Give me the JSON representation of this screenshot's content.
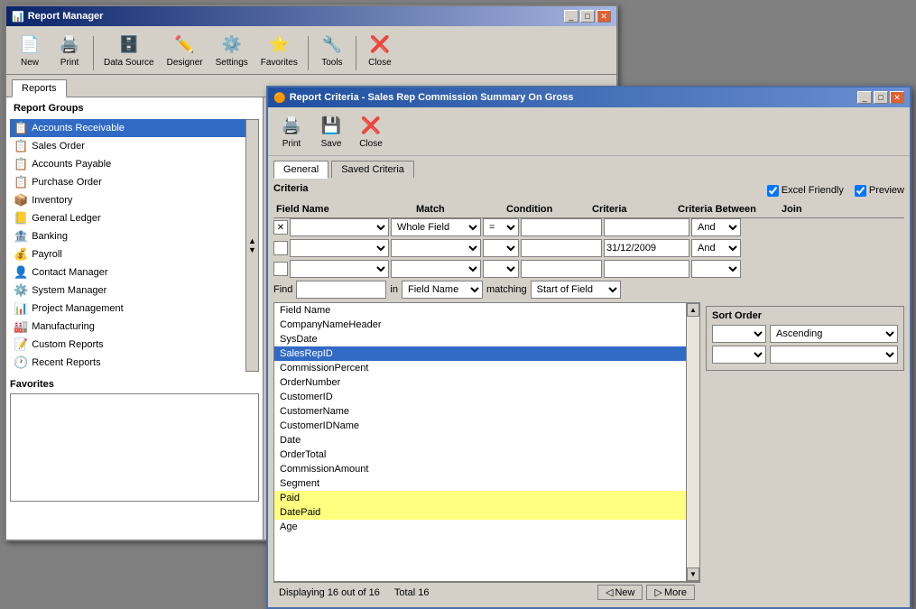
{
  "reportManager": {
    "title": "Report Manager",
    "toolbar": {
      "buttons": [
        {
          "label": "New",
          "icon": "📄",
          "name": "new-button"
        },
        {
          "label": "Print",
          "icon": "🖨️",
          "name": "print-button"
        },
        {
          "label": "Data Source",
          "icon": "🗄️",
          "name": "datasource-button"
        },
        {
          "label": "Designer",
          "icon": "✏️",
          "name": "designer-button"
        },
        {
          "label": "Settings",
          "icon": "⚙️",
          "name": "settings-button"
        },
        {
          "label": "Favorites",
          "icon": "⭐",
          "name": "favorites-button"
        },
        {
          "label": "Tools",
          "icon": "🔧",
          "name": "tools-button"
        },
        {
          "label": "Close",
          "icon": "❌",
          "name": "close-button"
        }
      ]
    },
    "tab": "Reports",
    "sidebarTitle": "Report Groups",
    "sidebarItems": [
      {
        "label": "Accounts Receivable",
        "icon": "📋",
        "selected": true
      },
      {
        "label": "Sales Order",
        "icon": "📋"
      },
      {
        "label": "Accounts Payable",
        "icon": "📋"
      },
      {
        "label": "Purchase Order",
        "icon": "📋"
      },
      {
        "label": "Inventory",
        "icon": "📦"
      },
      {
        "label": "General Ledger",
        "icon": "📒"
      },
      {
        "label": "Banking",
        "icon": "🏦"
      },
      {
        "label": "Payroll",
        "icon": "💰"
      },
      {
        "label": "Contact Manager",
        "icon": "👤"
      },
      {
        "label": "System Manager",
        "icon": "⚙️"
      },
      {
        "label": "Project Management",
        "icon": "📊"
      },
      {
        "label": "Manufacturing",
        "icon": "🏭"
      },
      {
        "label": "Custom Reports",
        "icon": "📝"
      },
      {
        "label": "Recent Reports",
        "icon": "🕐"
      }
    ],
    "favoritesTitle": "Favorites"
  },
  "criteriaWindow": {
    "title": "Report Criteria - Sales Rep Commission Summary On Gross",
    "toolbar": {
      "buttons": [
        {
          "label": "Print",
          "icon": "🖨️",
          "name": "criteria-print-button"
        },
        {
          "label": "Save",
          "icon": "💾",
          "name": "criteria-save-button"
        },
        {
          "label": "Close",
          "icon": "❌",
          "name": "criteria-close-button"
        }
      ]
    },
    "tabs": [
      {
        "label": "General",
        "active": true
      },
      {
        "label": "Saved Criteria",
        "active": false
      }
    ],
    "criteriaLabel": "Criteria",
    "excelFriendly": "Excel Friendly",
    "preview": "Preview",
    "tableHeaders": {
      "fieldName": "Field Name",
      "match": "Match",
      "condition": "Condition",
      "criteria": "Criteria",
      "criteriaBetween": "Criteria Between",
      "join": "Join"
    },
    "rows": [
      {
        "checkbox": "✕",
        "match": "Whole Field",
        "condition": "=",
        "criteria": "",
        "criteriaBetween": "",
        "join": "And"
      },
      {
        "checkbox": "",
        "match": "",
        "condition": "",
        "criteria": "",
        "criteriaBetween": "31/12/2009",
        "join": "And"
      },
      {
        "checkbox": "",
        "match": "",
        "condition": "",
        "criteria": "",
        "criteriaBetween": "",
        "join": ""
      }
    ],
    "findLabel": "Find",
    "inLabel": "in",
    "matchingLabel": "matching",
    "findIn": "Field Name",
    "findMatching": "Start of Field",
    "fieldList": [
      {
        "label": "Field Name",
        "selected": false,
        "highlighted": false
      },
      {
        "label": "CompanyNameHeader",
        "selected": false,
        "highlighted": false
      },
      {
        "label": "SysDate",
        "selected": false,
        "highlighted": false
      },
      {
        "label": "SalesRepID",
        "selected": true,
        "highlighted": false
      },
      {
        "label": "CommissionPercent",
        "selected": false,
        "highlighted": false
      },
      {
        "label": "OrderNumber",
        "selected": false,
        "highlighted": false
      },
      {
        "label": "CustomerID",
        "selected": false,
        "highlighted": false
      },
      {
        "label": "CustomerName",
        "selected": false,
        "highlighted": false
      },
      {
        "label": "CustomerIDName",
        "selected": false,
        "highlighted": false
      },
      {
        "label": "Date",
        "selected": false,
        "highlighted": false
      },
      {
        "label": "OrderTotal",
        "selected": false,
        "highlighted": false
      },
      {
        "label": "CommissionAmount",
        "selected": false,
        "highlighted": false
      },
      {
        "label": "Segment",
        "selected": false,
        "highlighted": false
      },
      {
        "label": "Paid",
        "selected": false,
        "highlighted": true
      },
      {
        "label": "DatePaid",
        "selected": false,
        "highlighted": true
      },
      {
        "label": "Age",
        "selected": false,
        "highlighted": false
      }
    ],
    "statusDisplaying": "Displaying 16 out of 16",
    "statusTotal": "Total 16",
    "newButton": "New",
    "moreButton": "More",
    "sortOrderTitle": "Sort Order",
    "sortRows": [
      {
        "value": "Ascending"
      },
      {
        "value": ""
      }
    ]
  }
}
